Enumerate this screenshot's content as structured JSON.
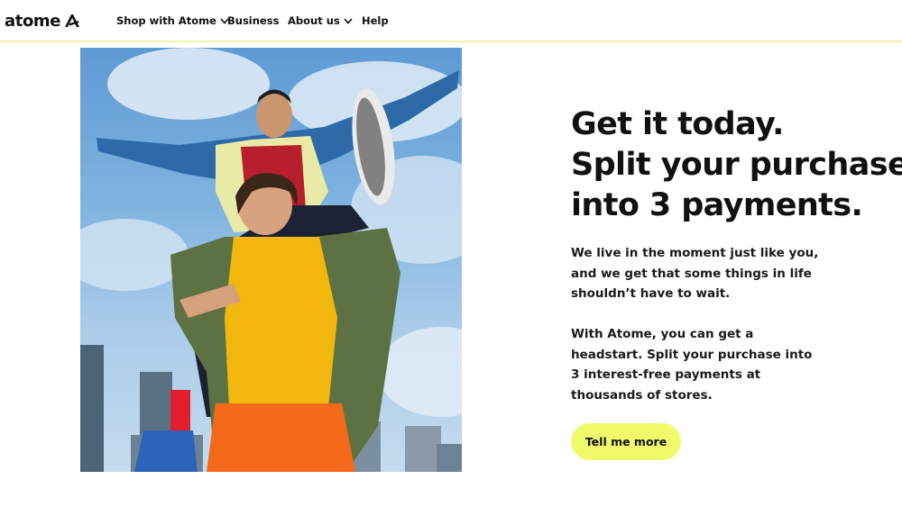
{
  "nav": {
    "logo": "atome",
    "items": [
      {
        "label": "Shop with Atome",
        "dropdown": true
      },
      {
        "label": "Business",
        "dropdown": false
      },
      {
        "label": "About us",
        "dropdown": true
      },
      {
        "label": "Help",
        "dropdown": false
      }
    ]
  },
  "hero": {
    "headline_lines": [
      "Get it today.",
      "Split your purchase",
      "into 3 payments."
    ],
    "paragraph1_lines": [
      "We live in the moment just like you,",
      "and we get that some things in life",
      "shouldn’t have to wait."
    ],
    "paragraph2_lines": [
      "With Atome, you can get a",
      "headstart. Split your purchase into",
      "3 interest-free payments at",
      "thousands of stores."
    ],
    "cta_label": "Tell me more"
  },
  "colors": {
    "accent": "#f0fa6b",
    "nav_border": "#f0f5a3",
    "text": "#111111"
  }
}
